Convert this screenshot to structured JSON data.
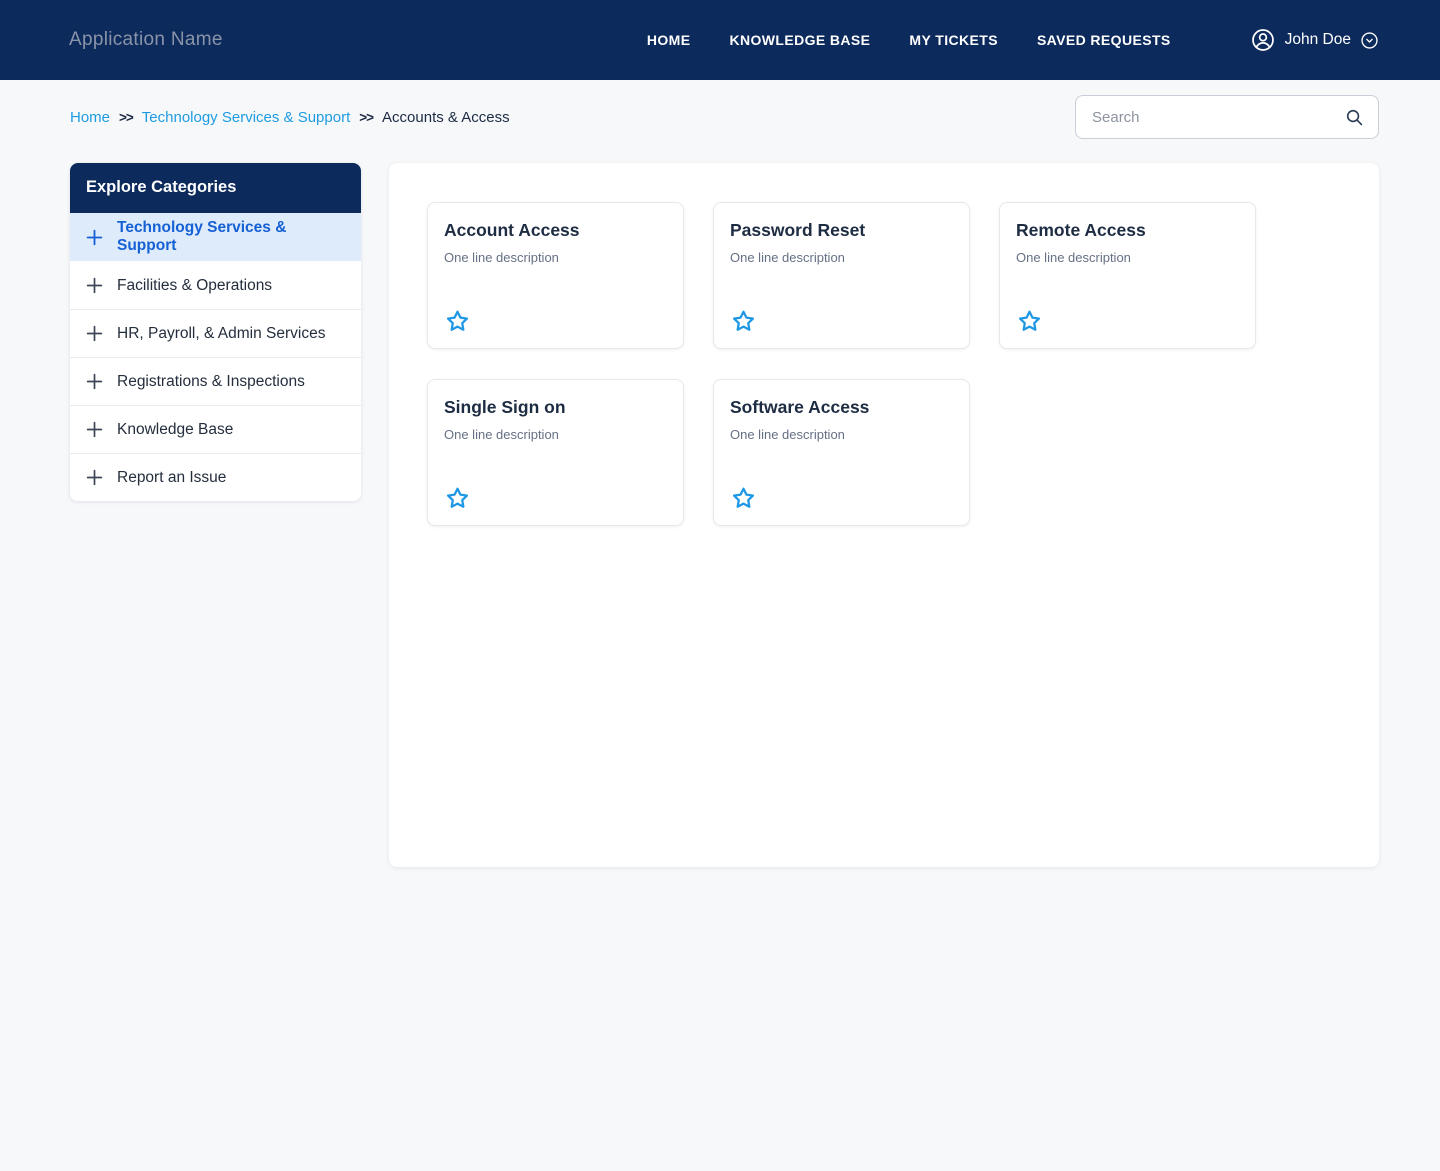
{
  "header": {
    "app_title": "Application Name",
    "nav": [
      {
        "label": "HOME"
      },
      {
        "label": "KNOWLEDGE BASE"
      },
      {
        "label": "MY TICKETS"
      },
      {
        "label": "SAVED REQUESTS"
      }
    ],
    "user": {
      "name": "John Doe",
      "icons": [
        "user-circle-icon",
        "chevron-down-circle-icon"
      ]
    }
  },
  "breadcrumb": {
    "separator": ">>",
    "items": [
      {
        "label": "Home"
      },
      {
        "label": "Technology Services & Support"
      },
      {
        "label": "Accounts & Access"
      }
    ]
  },
  "search": {
    "placeholder": "Search",
    "icon": "search-icon"
  },
  "sidebar": {
    "title": "Explore Categories",
    "item_icon": "plus-icon",
    "items": [
      {
        "label": "Technology Services & Support",
        "active": true
      },
      {
        "label": "Facilities & Operations",
        "active": false
      },
      {
        "label": "HR, Payroll, & Admin Services",
        "active": false
      },
      {
        "label": "Registrations & Inspections",
        "active": false
      },
      {
        "label": "Knowledge Base",
        "active": false
      },
      {
        "label": "Report an Issue",
        "active": false
      }
    ]
  },
  "cards": [
    {
      "title": "Account Access",
      "description": "One line description",
      "icon": "star-outline-icon"
    },
    {
      "title": "Password Reset",
      "description": "One line description",
      "icon": "star-outline-icon"
    },
    {
      "title": "Remote Access",
      "description": "One line description",
      "icon": "star-outline-icon"
    },
    {
      "title": "Single Sign on",
      "description": "One line description",
      "icon": "star-outline-icon"
    },
    {
      "title": "Software Access",
      "description": "One line description",
      "icon": "star-outline-icon"
    }
  ],
  "colors": {
    "header_bg": "#0d2a5c",
    "page_bg": "#f7f8fa",
    "breadcrumb_link": "#1e9ce2",
    "sidebar_active_text": "#1560d4",
    "sidebar_active_bg": "#ddebfb",
    "star_blue": "#1e97e4",
    "title_text": "#1d2c42",
    "description_text": "#667085",
    "app_title_text": "#8a94a9"
  }
}
